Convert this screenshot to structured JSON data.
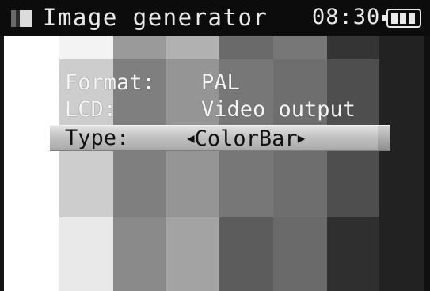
{
  "titlebar": {
    "icon": "image-generator-icon",
    "title": "Image generator",
    "clock": "08:30",
    "battery_icon": "battery-full-icon",
    "battery_level": 1.0
  },
  "pattern": {
    "name": "ColorBar"
  },
  "menu": {
    "format_label": "Format:",
    "format_value": "PAL",
    "lcd_label": "LCD:",
    "lcd_value": "Video output",
    "type_label": "Type:",
    "type_value": "ColorBar",
    "left_arrow": "◀",
    "right_arrow": "▶",
    "selected_row": "type",
    "selection_color": "#c4c4c4"
  }
}
